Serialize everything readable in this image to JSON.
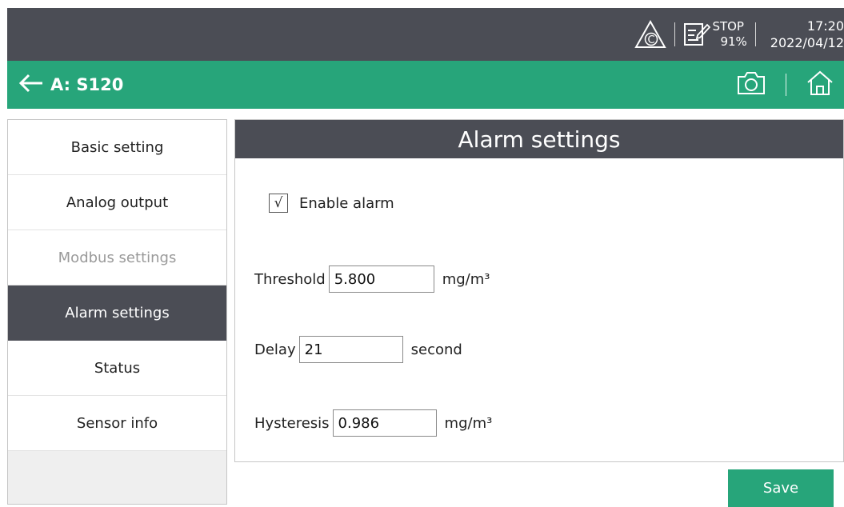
{
  "statusbar": {
    "alarm_icon_letter": "C",
    "run_state": "STOP",
    "battery": "91%",
    "time": "17:20",
    "date": "2022/04/12"
  },
  "navbar": {
    "title": "A: S120"
  },
  "sidebar": {
    "items": [
      {
        "label": "Basic setting",
        "state": "normal"
      },
      {
        "label": "Analog output",
        "state": "normal"
      },
      {
        "label": "Modbus settings",
        "state": "disabled"
      },
      {
        "label": "Alarm settings",
        "state": "active"
      },
      {
        "label": "Status",
        "state": "normal"
      },
      {
        "label": "Sensor info",
        "state": "normal"
      }
    ]
  },
  "main": {
    "title": "Alarm settings",
    "enable_alarm": {
      "label": "Enable alarm",
      "checked": true,
      "check_glyph": "√"
    },
    "threshold": {
      "label": "Threshold",
      "value": "5.800",
      "unit": "mg/m³"
    },
    "delay": {
      "label": "Delay",
      "value": "21",
      "unit": "second"
    },
    "hysteresis": {
      "label": "Hysteresis",
      "value": "0.986",
      "unit": "mg/m³"
    }
  },
  "actions": {
    "save_label": "Save"
  },
  "colors": {
    "accent": "#27a57a",
    "dark": "#4b4d55",
    "disabled_text": "#9a9a9a"
  }
}
